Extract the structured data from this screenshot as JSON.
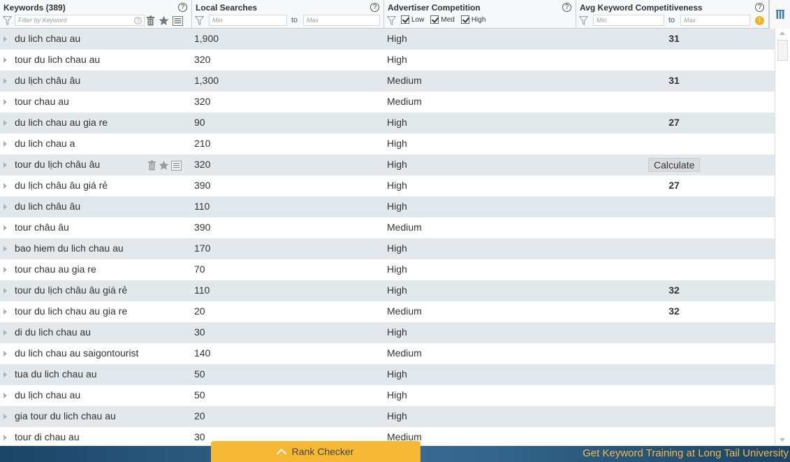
{
  "header": {
    "keywords_title": "Keywords (389)",
    "keywords_filter_placeholder": "Filter by Keyword",
    "local_title": "Local Searches",
    "local_min_placeholder": "Min",
    "local_max_placeholder": "Max",
    "to_label": "to",
    "adv_title": "Advertiser Competition",
    "adv_low": "Low",
    "adv_med": "Med",
    "adv_high": "High",
    "akc_title": "Avg Keyword Competitiveness",
    "akc_min_placeholder": "Min",
    "akc_max_placeholder": "Max",
    "help_glyph": "?",
    "warn_glyph": "!"
  },
  "rows": [
    {
      "keyword": "du lich chau au",
      "local": "1,900",
      "competition": "High",
      "akc": "31"
    },
    {
      "keyword": "tour du lich chau au",
      "local": "320",
      "competition": "High",
      "akc": ""
    },
    {
      "keyword": "du lịch châu âu",
      "local": "1,300",
      "competition": "Medium",
      "akc": "31"
    },
    {
      "keyword": "tour chau au",
      "local": "320",
      "competition": "Medium",
      "akc": ""
    },
    {
      "keyword": "du lich chau au gia re",
      "local": "90",
      "competition": "High",
      "akc": "27"
    },
    {
      "keyword": "du lich chau a",
      "local": "210",
      "competition": "High",
      "akc": ""
    },
    {
      "keyword": "tour du lịch châu âu",
      "local": "320",
      "competition": "High",
      "akc": "",
      "calculate": "Calculate"
    },
    {
      "keyword": "du lịch châu âu giá rẻ",
      "local": "390",
      "competition": "High",
      "akc": "27"
    },
    {
      "keyword": "du lich châu âu",
      "local": "110",
      "competition": "High",
      "akc": ""
    },
    {
      "keyword": "tour châu âu",
      "local": "390",
      "competition": "Medium",
      "akc": ""
    },
    {
      "keyword": "bao hiem du lich chau au",
      "local": "170",
      "competition": "High",
      "akc": ""
    },
    {
      "keyword": "tour chau au gia re",
      "local": "70",
      "competition": "High",
      "akc": ""
    },
    {
      "keyword": "tour du lịch châu âu giá rẻ",
      "local": "110",
      "competition": "High",
      "akc": "32"
    },
    {
      "keyword": "tour du lich chau au gia re",
      "local": "20",
      "competition": "Medium",
      "akc": "32"
    },
    {
      "keyword": "di du lich chau au",
      "local": "30",
      "competition": "High",
      "akc": ""
    },
    {
      "keyword": "du lich chau au saigontourist",
      "local": "140",
      "competition": "Medium",
      "akc": ""
    },
    {
      "keyword": "tua du lich chau au",
      "local": "50",
      "competition": "High",
      "akc": ""
    },
    {
      "keyword": "du lịch chau au",
      "local": "50",
      "competition": "High",
      "akc": ""
    },
    {
      "keyword": "gia tour du lich chau au",
      "local": "20",
      "competition": "High",
      "akc": ""
    },
    {
      "keyword": "tour di chau au",
      "local": "30",
      "competition": "Medium",
      "akc": ""
    }
  ],
  "footer": {
    "rank_checker_label": "Rank Checker",
    "training_text": "Get Keyword Training at Long Tail University"
  },
  "colors": {
    "row_alt": "#e3e8ec",
    "footer_bg": "#2b5b82",
    "rank_tab": "#f5b935",
    "training_text": "#f2b94a"
  }
}
